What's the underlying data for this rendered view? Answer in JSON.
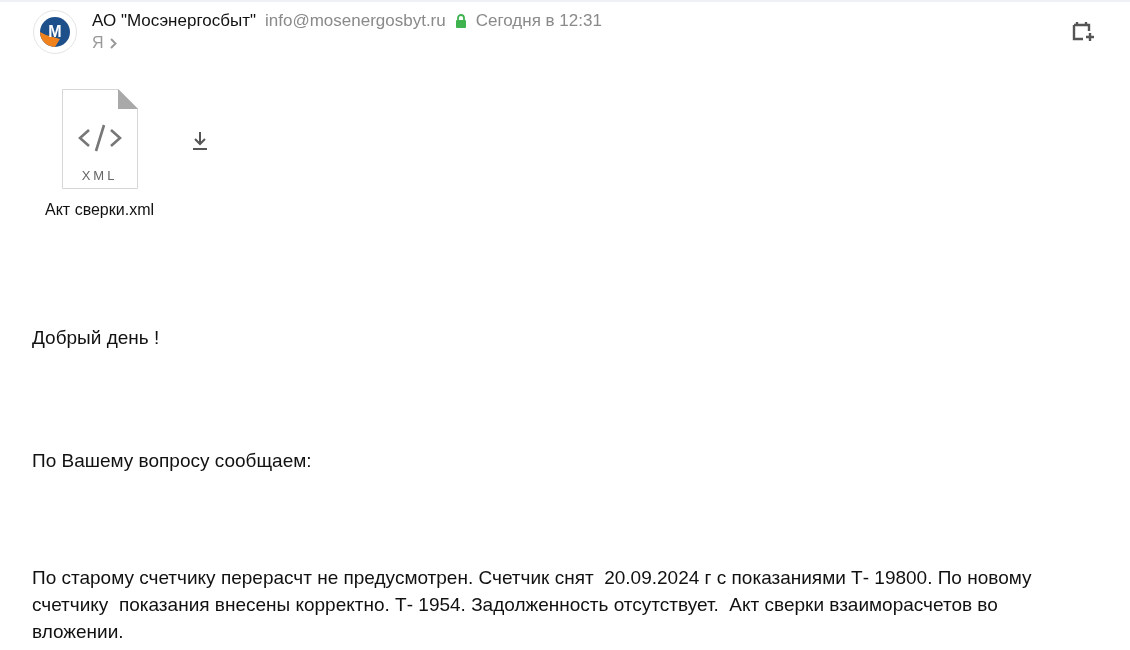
{
  "sender": {
    "avatar_letter": "M",
    "name": "АО \"Мосэнергосбыт\"",
    "email": "info@mosenergosbyt.ru",
    "verified": true,
    "date": "Сегодня в 12:31",
    "recipient": "Я"
  },
  "attachment": {
    "file_type": "XML",
    "file_name": "Акт сверки.xml"
  },
  "body": [
    "Добрый день !",
    "По Вашему вопросу сообщаем:",
    "По старому счетчику перерасчт не предусмотрен. Счетчик снят  20.09.2024 г с показаниями Т- 19800. По новому счетчику  показания внесены корректно. Т- 1954. Задолженность отсутствует.  Акт сверки взаиморасчетов во вложении."
  ]
}
